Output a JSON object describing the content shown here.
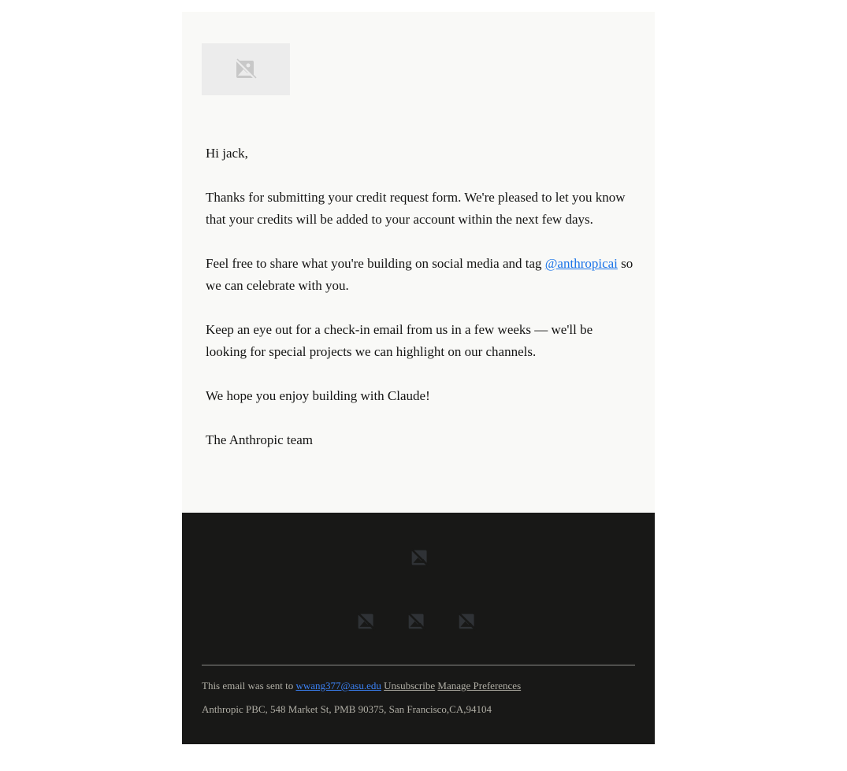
{
  "message": {
    "greeting": "Hi jack,",
    "para1": "Thanks for submitting your credit request form. We're pleased to let you know that your credits will be added to your account within the next few days.",
    "para2_before": "Feel free to share what you're building on social media and tag ",
    "para2_link": "@anthropicai",
    "para2_after": " so we can celebrate with you.",
    "para3": "Keep an eye out for a check-in email from us in a few weeks — we'll be looking for special projects we can highlight on our channels.",
    "para4": "We hope you enjoy building with Claude!",
    "signoff": "The Anthropic team"
  },
  "header": {
    "logo_icon": "broken-image-icon"
  },
  "footer": {
    "logo_icon": "broken-image-icon",
    "social_icons": [
      "broken-image-icon",
      "broken-image-icon",
      "broken-image-icon"
    ],
    "sent_prefix": "This email was sent to ",
    "email": "wwang377@asu.edu",
    "unsubscribe": "Unsubscribe",
    "manage": "Manage Preferences",
    "address": "Anthropic PBC, 548 Market St, PMB 90375, San Francisco,CA,94104"
  },
  "colors": {
    "body_bg": "#f9f9f7",
    "footer_bg": "#181817",
    "link": "#1a73e8",
    "text": "#141413",
    "footer_text": "#b0aea5"
  }
}
